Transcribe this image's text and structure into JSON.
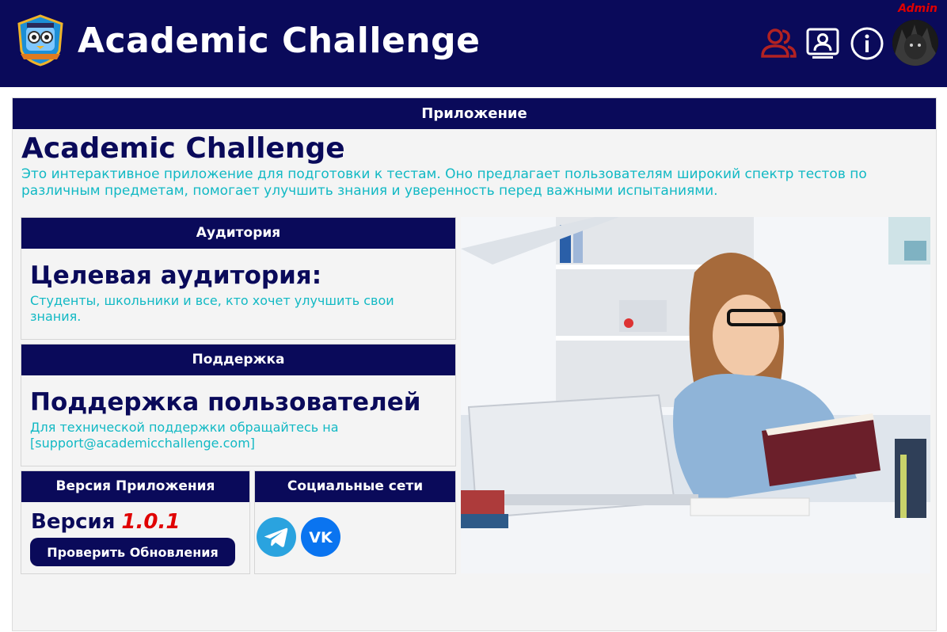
{
  "header": {
    "title": "Academic Challenge",
    "role_badge": "Admin",
    "icons": [
      "users-icon",
      "profile-card-icon",
      "info-icon"
    ],
    "brand_color": "#0a0a5a",
    "accent_color": "#12b9c4",
    "highlight_color": "#e00000"
  },
  "card": {
    "header": "Приложение",
    "title": "Academic Challenge",
    "description": "Это интерактивное приложение для подготовки к тестам. Оно предлагает пользователям широкий спектр тестов по различным предметам, помогает улучшить знания и уверенность перед важными испытаниями."
  },
  "audience": {
    "header": "Аудитория",
    "title": "Целевая аудитория:",
    "text": "Студенты, школьники и все, кто хочет улучшить свои знания."
  },
  "support": {
    "header": "Поддержка",
    "title": "Поддержка пользователей",
    "text": "Для технической поддержки обращайтесь на [support@academicchallenge.com]"
  },
  "version": {
    "header": "Версия Приложения",
    "label": "Версия",
    "number": "1.0.1",
    "button_label": "Проверить Обновления"
  },
  "social": {
    "header": "Социальные сети",
    "icons": [
      "telegram-icon",
      "vk-icon"
    ]
  }
}
